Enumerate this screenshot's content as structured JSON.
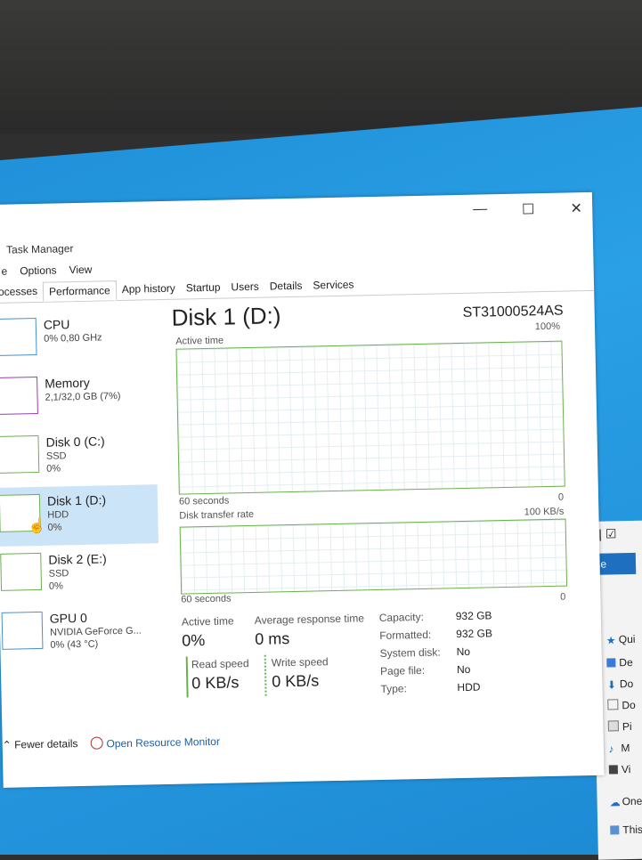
{
  "window": {
    "title": "Task Manager",
    "controls": {
      "minimize": "—",
      "maximize": "☐",
      "close": "✕"
    }
  },
  "menu": [
    "e",
    "Options",
    "View"
  ],
  "tabs": [
    "ocesses",
    "Performance",
    "App history",
    "Startup",
    "Users",
    "Details",
    "Services"
  ],
  "active_tab": "Performance",
  "sidebar": [
    {
      "name": "CPU",
      "sub1": "0% 0,80 GHz",
      "sub2": ""
    },
    {
      "name": "Memory",
      "sub1": "2,1/32,0 GB (7%)",
      "sub2": ""
    },
    {
      "name": "Disk 0 (C:)",
      "sub1": "SSD",
      "sub2": "0%"
    },
    {
      "name": "Disk 1 (D:)",
      "sub1": "HDD",
      "sub2": "0%"
    },
    {
      "name": "Disk 2 (E:)",
      "sub1": "SSD",
      "sub2": "0%"
    },
    {
      "name": "GPU 0",
      "sub1": "NVIDIA GeForce G...",
      "sub2": "0% (43 °C)"
    }
  ],
  "main": {
    "title": "Disk 1 (D:)",
    "model": "ST31000524AS",
    "graph1": {
      "label": "Active time",
      "max": "100%",
      "xaxis": "60 seconds",
      "min": "0"
    },
    "graph2": {
      "label": "Disk transfer rate",
      "max": "100 KB/s",
      "xaxis": "60 seconds",
      "min": "0"
    },
    "stats": {
      "active_time_label": "Active time",
      "active_time": "0%",
      "avg_resp_label": "Average response time",
      "avg_resp": "0 ms",
      "read_label": "Read speed",
      "read": "0 KB/s",
      "write_label": "Write speed",
      "write": "0 KB/s"
    },
    "properties": [
      {
        "label": "Capacity:",
        "value": "932 GB"
      },
      {
        "label": "Formatted:",
        "value": "932 GB"
      },
      {
        "label": "System disk:",
        "value": "No"
      },
      {
        "label": "Page file:",
        "value": "No"
      },
      {
        "label": "Type:",
        "value": "HDD"
      }
    ]
  },
  "footer": {
    "fewer": "Fewer details",
    "resmon": "Open Resource Monitor"
  },
  "explorer": {
    "file": "ile",
    "items": [
      "Qui",
      "De",
      "Do",
      "Do",
      "Pi",
      "M",
      "Vi",
      "One",
      "This"
    ]
  }
}
